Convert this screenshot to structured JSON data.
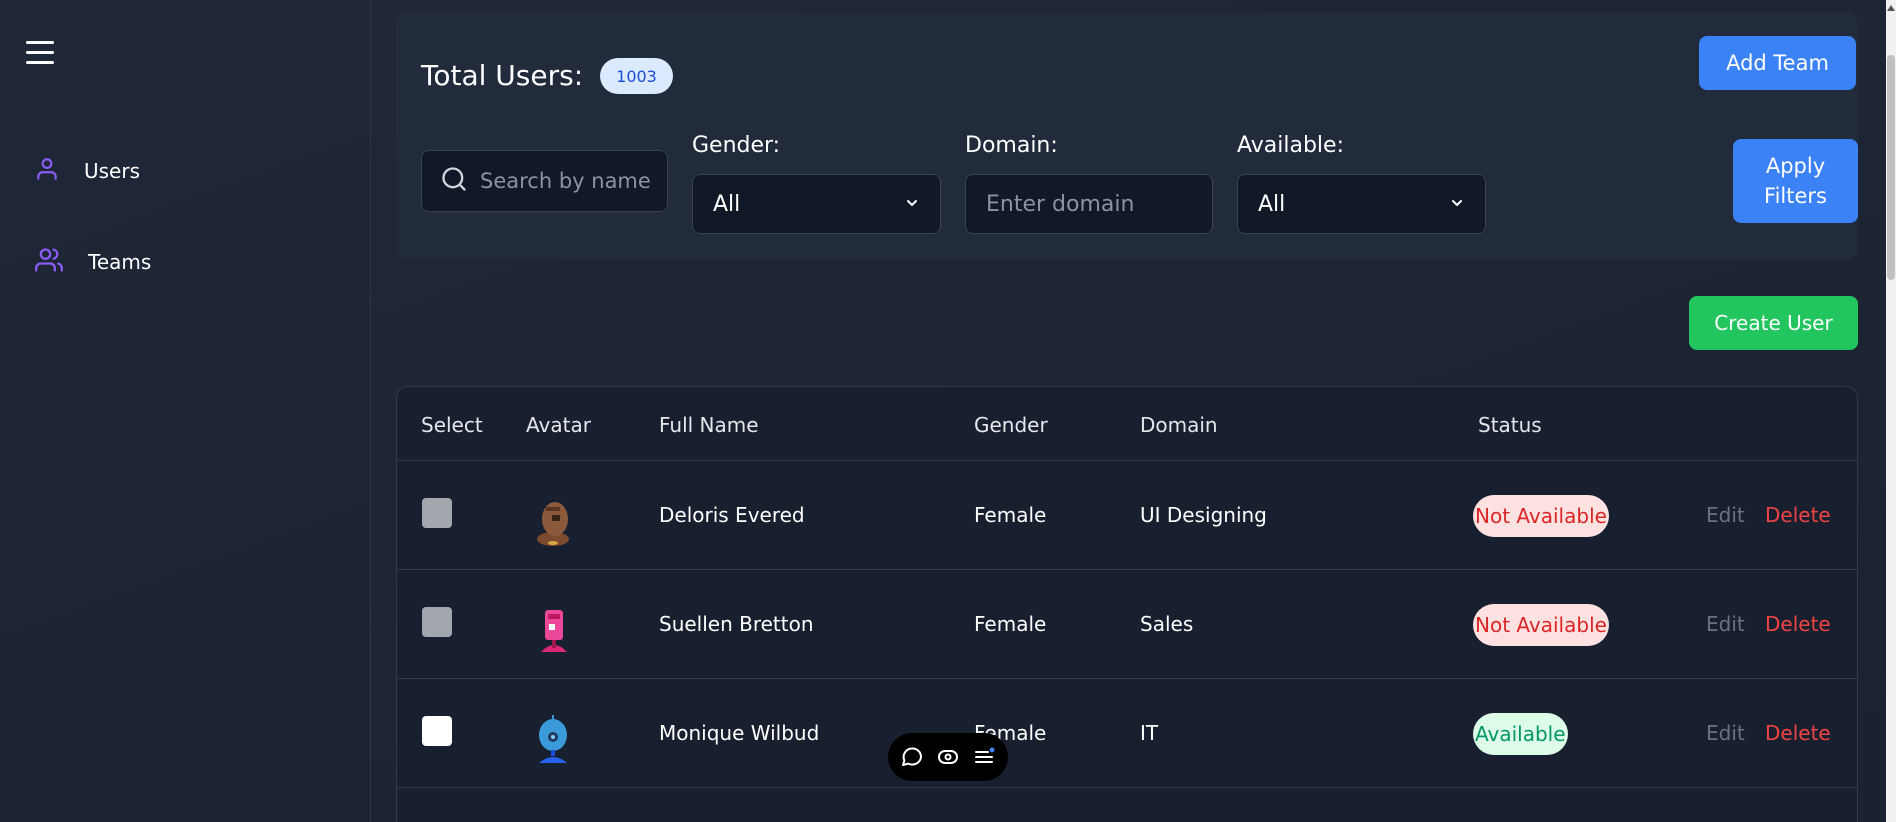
{
  "sidebar": {
    "items": [
      {
        "label": "Users",
        "icon": "user-icon"
      },
      {
        "label": "Teams",
        "icon": "users-icon"
      }
    ]
  },
  "header": {
    "title": "Total Users:",
    "count": "1003",
    "add_team": "Add Team"
  },
  "filters": {
    "search_placeholder": "Search by name",
    "gender_label": "Gender:",
    "gender_value": "All",
    "domain_label": "Domain:",
    "domain_placeholder": "Enter domain",
    "available_label": "Available:",
    "available_value": "All",
    "apply_line1": "Apply",
    "apply_line2": "Filters"
  },
  "actions": {
    "create_user": "Create User"
  },
  "table": {
    "columns": [
      "Select",
      "Avatar",
      "Full Name",
      "Gender",
      "Domain",
      "Status"
    ],
    "rows": [
      {
        "name": "Deloris Evered",
        "gender": "Female",
        "domain": "UI Designing",
        "status": "Not Available",
        "selected": false,
        "edit": "Edit",
        "delete": "Delete"
      },
      {
        "name": "Suellen Bretton",
        "gender": "Female",
        "domain": "Sales",
        "status": "Not Available",
        "selected": false,
        "edit": "Edit",
        "delete": "Delete"
      },
      {
        "name": "Monique Wilbud",
        "gender": "Female",
        "domain": "IT",
        "status": "Available",
        "selected": false,
        "edit": "Edit",
        "delete": "Delete"
      }
    ]
  },
  "colors": {
    "accent_blue": "#3b82f6",
    "create_green": "#22c55e",
    "not_available_text": "#dc2626",
    "available_text": "#059669",
    "sidebar_icon": "#8b5cf6"
  },
  "floating_toolbar": {
    "icons": [
      "comment-icon",
      "eye-icon",
      "menu-list-icon"
    ]
  }
}
